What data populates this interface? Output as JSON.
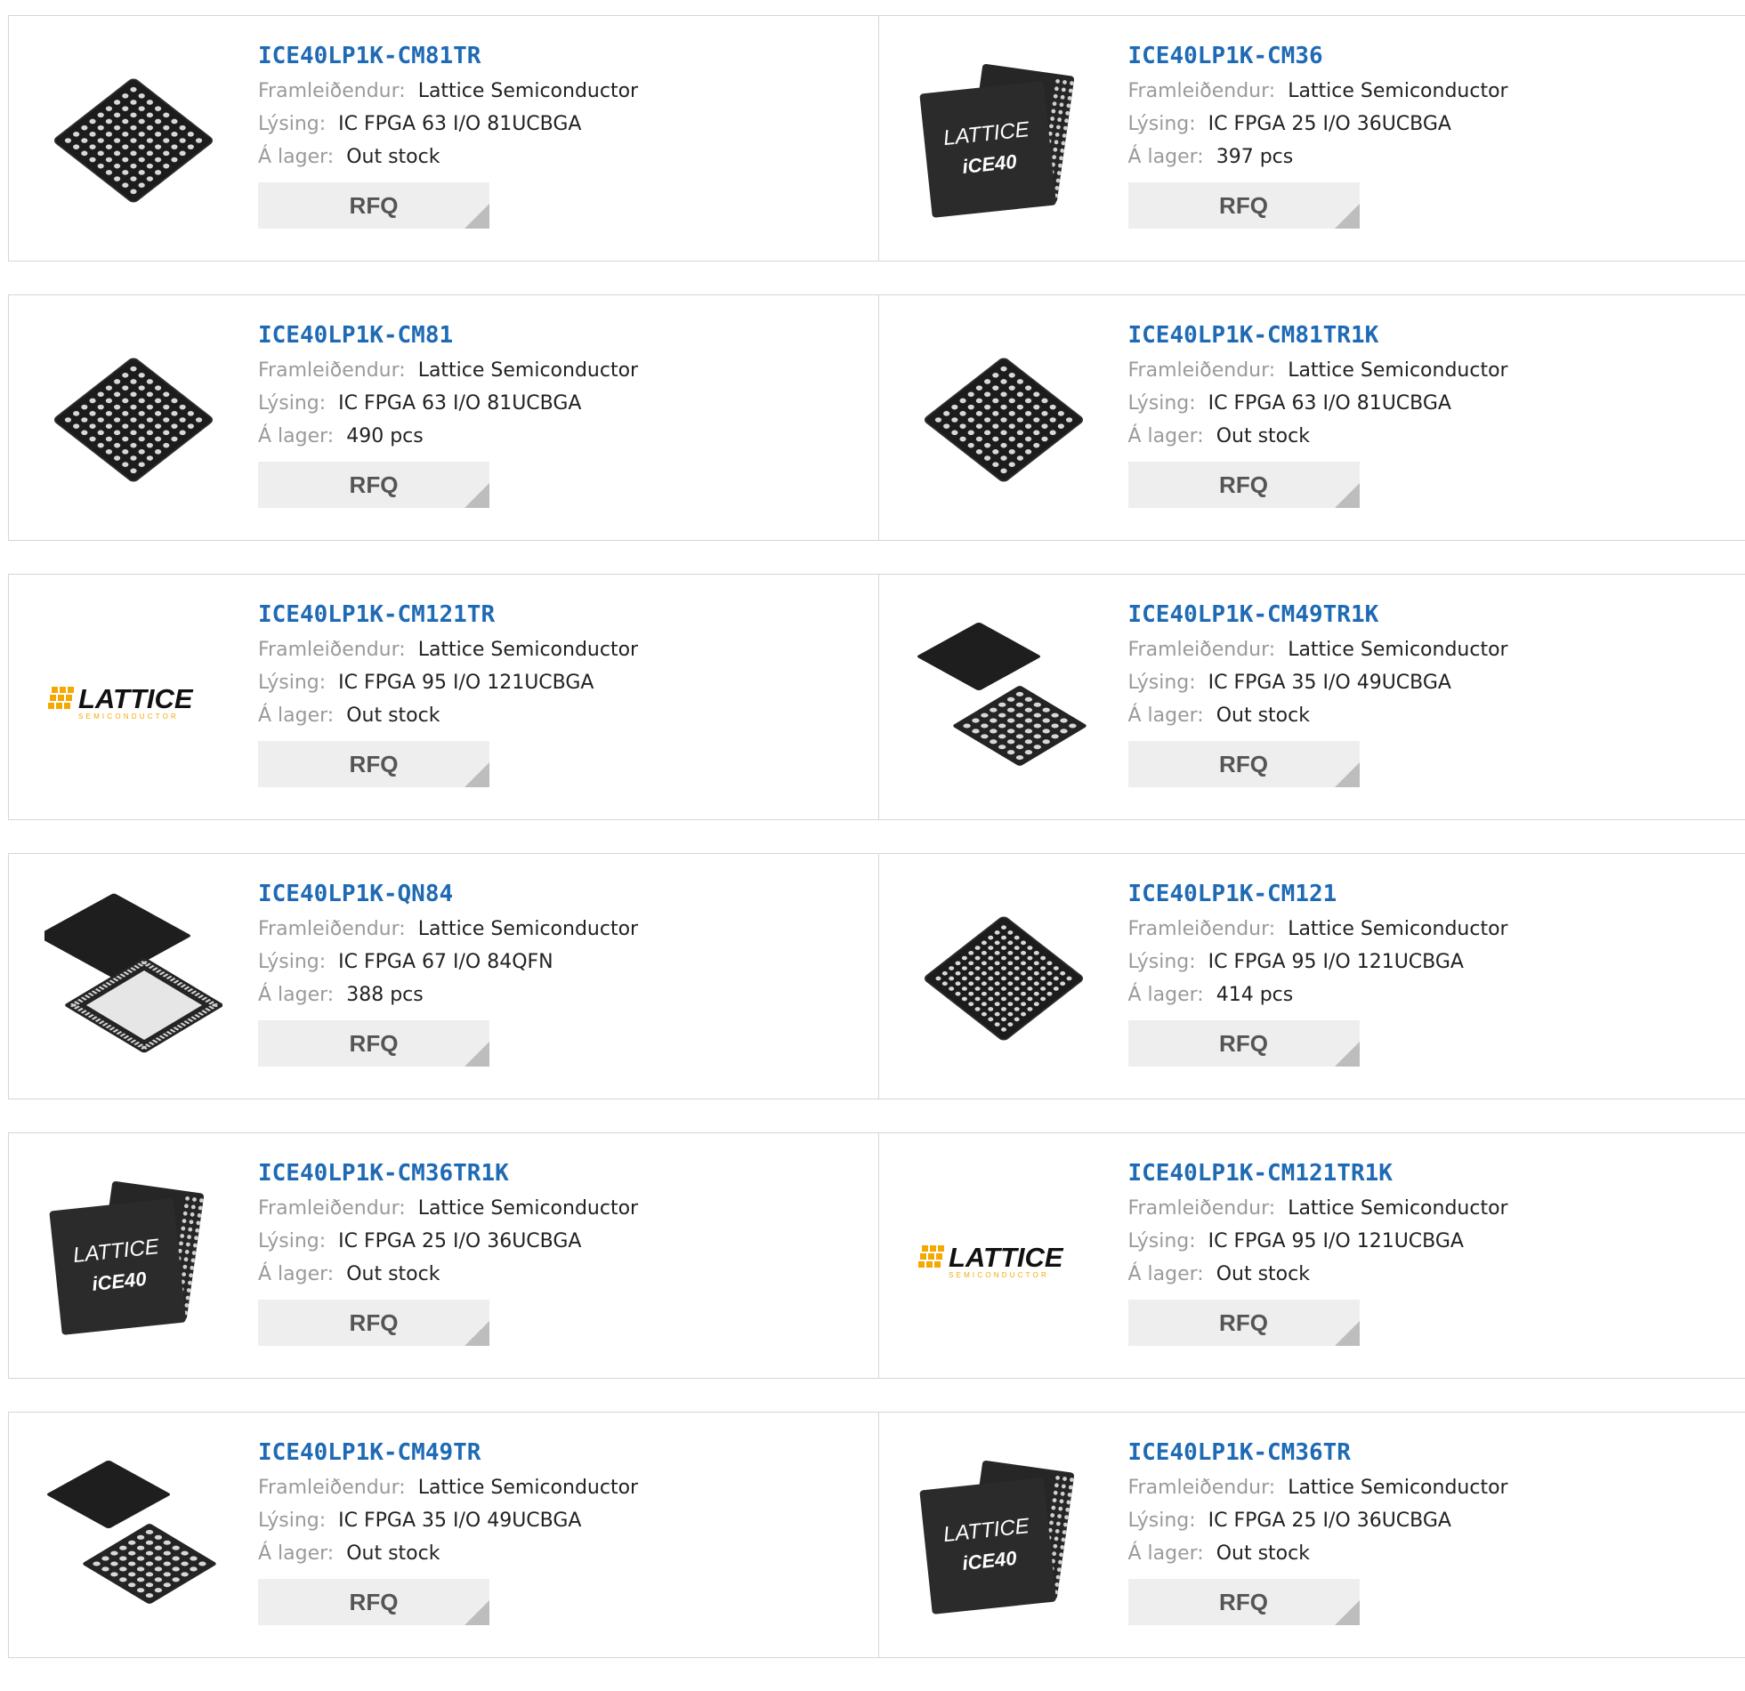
{
  "labels": {
    "manufacturer": "Framleiðendur:",
    "description": "Lýsing:",
    "stock": "Á lager:",
    "rfq": "RFQ"
  },
  "brand_logo": {
    "word": "LATTICE",
    "sub": "SEMICONDUCTOR"
  },
  "chip_text": {
    "line1": "LATTICE",
    "line2": "iCE40"
  },
  "products": [
    {
      "part": "ICE40LP1K-CM81TR",
      "manufacturer": "Lattice Semiconductor",
      "description": "IC FPGA 63 I/O 81UCBGA",
      "stock": "Out stock",
      "image": "bga-81"
    },
    {
      "part": "ICE40LP1K-CM36",
      "manufacturer": "Lattice Semiconductor",
      "description": "IC FPGA 25 I/O 36UCBGA",
      "stock": "397 pcs",
      "image": "ice40-chip"
    },
    {
      "part": "ICE40LP1K-CM81",
      "manufacturer": "Lattice Semiconductor",
      "description": "IC FPGA 63 I/O 81UCBGA",
      "stock": "490 pcs",
      "image": "bga-81"
    },
    {
      "part": "ICE40LP1K-CM81TR1K",
      "manufacturer": "Lattice Semiconductor",
      "description": "IC FPGA 63 I/O 81UCBGA",
      "stock": "Out stock",
      "image": "bga-81"
    },
    {
      "part": "ICE40LP1K-CM121TR",
      "manufacturer": "Lattice Semiconductor",
      "description": "IC FPGA 95 I/O 121UCBGA",
      "stock": "Out stock",
      "image": "lattice-logo"
    },
    {
      "part": "ICE40LP1K-CM49TR1K",
      "manufacturer": "Lattice Semiconductor",
      "description": "IC FPGA 35 I/O 49UCBGA",
      "stock": "Out stock",
      "image": "bga-49-pair"
    },
    {
      "part": "ICE40LP1K-QN84",
      "manufacturer": "Lattice Semiconductor",
      "description": "IC FPGA 67 I/O 84QFN",
      "stock": "388 pcs",
      "image": "qfn-84-pair"
    },
    {
      "part": "ICE40LP1K-CM121",
      "manufacturer": "Lattice Semiconductor",
      "description": "IC FPGA 95 I/O 121UCBGA",
      "stock": "414 pcs",
      "image": "bga-121"
    },
    {
      "part": "ICE40LP1K-CM36TR1K",
      "manufacturer": "Lattice Semiconductor",
      "description": "IC FPGA 25 I/O 36UCBGA",
      "stock": "Out stock",
      "image": "ice40-chip"
    },
    {
      "part": "ICE40LP1K-CM121TR1K",
      "manufacturer": "Lattice Semiconductor",
      "description": "IC FPGA 95 I/O 121UCBGA",
      "stock": "Out stock",
      "image": "lattice-logo"
    },
    {
      "part": "ICE40LP1K-CM49TR",
      "manufacturer": "Lattice Semiconductor",
      "description": "IC FPGA 35 I/O 49UCBGA",
      "stock": "Out stock",
      "image": "bga-49-pair"
    },
    {
      "part": "ICE40LP1K-CM36TR",
      "manufacturer": "Lattice Semiconductor",
      "description": "IC FPGA 25 I/O 36UCBGA",
      "stock": "Out stock",
      "image": "ice40-chip"
    }
  ],
  "colors": {
    "link": "#1e6ab4",
    "label": "#9a9a9a",
    "value": "#222222",
    "border": "#d6d6d6",
    "button_bg": "#eeeeee",
    "button_text": "#555555",
    "logo_orange": "#f5a800"
  }
}
